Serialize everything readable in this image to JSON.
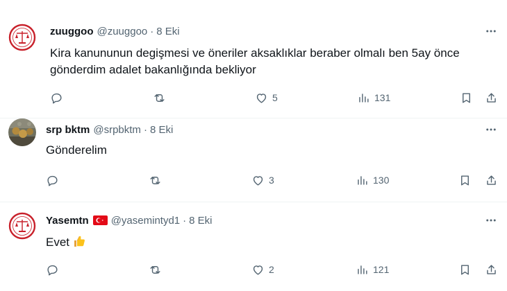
{
  "tweets": [
    {
      "display_name": "zuuggoo",
      "handle": "@zuuggoo",
      "separator": "·",
      "time": "8 Eki",
      "text": "Kira kanununun degişmesi ve öneriler aksaklıklar beraber olmalı ben 5ay önce gönderdim adalet bakanlığında bekliyor",
      "avatar_icon": "justice-scales-logo-icon",
      "like_count": "5",
      "view_count": "131"
    },
    {
      "display_name": "srp bktm",
      "handle": "@srpbktm",
      "separator": "·",
      "time": "8 Eki",
      "text": "Gönderelim",
      "avatar_icon": "photo-avatar",
      "like_count": "3",
      "view_count": "130"
    },
    {
      "display_name": "Yasemtn",
      "handle": "@yasemintyd1",
      "separator": "·",
      "time": "8 Eki",
      "text": "Evet",
      "text_emoji": "thumbs-up-icon",
      "name_emoji": "turkey-flag-icon",
      "avatar_icon": "justice-scales-logo-icon",
      "like_count": "2",
      "view_count": "121"
    }
  ],
  "colors": {
    "text": "#0f1419",
    "secondary": "#536471",
    "divider": "#eff3f4",
    "logo_red": "#c8202a"
  }
}
